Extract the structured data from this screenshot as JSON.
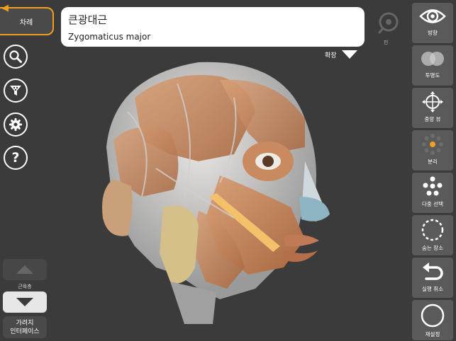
{
  "nav": {
    "back_label": "차례"
  },
  "title": {
    "korean": "큰광대근",
    "latin": "Zygomaticus major"
  },
  "pin": {
    "label": "핀"
  },
  "expand": {
    "label": "확장"
  },
  "layers": {
    "label": "근육층"
  },
  "interface": {
    "label_line1": "가려지",
    "label_line2": "인터페이스"
  },
  "toolbar": [
    {
      "label": "방향",
      "icon": "eye-icon"
    },
    {
      "label": "투명도",
      "icon": "transparency-icon"
    },
    {
      "label": "중앙 뷰",
      "icon": "center-view-icon"
    },
    {
      "label": "분리",
      "icon": "isolate-icon"
    },
    {
      "label": "다중 선택",
      "icon": "multi-select-icon"
    },
    {
      "label": "숨는 장소",
      "icon": "hide-icon"
    },
    {
      "label": "실행 취소",
      "icon": "undo-icon"
    },
    {
      "label": "재설정",
      "icon": "reset-icon"
    }
  ],
  "colors": {
    "accent": "#f0a020",
    "background": "#3b3b3b",
    "toolbar": "#5a5a5a"
  }
}
